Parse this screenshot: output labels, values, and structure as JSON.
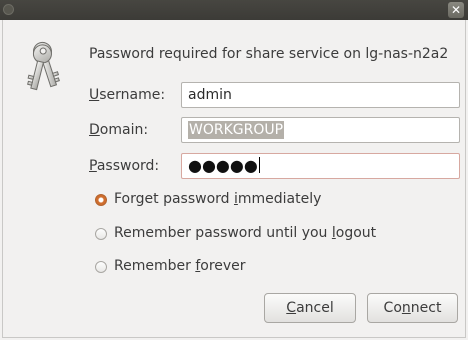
{
  "dialog": {
    "message": "Password required for share service on lg-nas-n2a2",
    "close_glyph": "✕"
  },
  "form": {
    "username": {
      "label_mnemonic": "U",
      "label_rest": "sername:",
      "value": "admin"
    },
    "domain": {
      "label_mnemonic": "D",
      "label_rest": "omain:",
      "value": "WORKGROUP"
    },
    "password": {
      "label_mnemonic": "P",
      "label_rest": "assword:",
      "masked_value": "●●●●●"
    }
  },
  "options": {
    "forget": {
      "before": "Forget password ",
      "mnemonic": "i",
      "after": "mmediately",
      "selected": true
    },
    "logout": {
      "before": "Remember password until you ",
      "mnemonic": "l",
      "after": "ogout",
      "selected": false
    },
    "forever": {
      "before": "Remember ",
      "mnemonic": "f",
      "after": "orever",
      "selected": false
    }
  },
  "buttons": {
    "cancel": {
      "before": "",
      "mnemonic": "C",
      "after": "ancel"
    },
    "connect": {
      "before": "Co",
      "mnemonic": "n",
      "after": "nect"
    }
  },
  "icons": {
    "dialog": "keys-icon",
    "close": "close-icon",
    "window_menu": "window-menu-icon"
  }
}
